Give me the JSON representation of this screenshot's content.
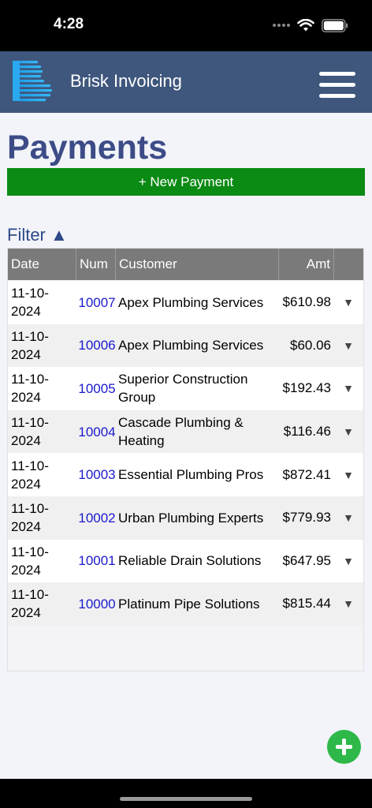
{
  "status_bar": {
    "time": "4:28"
  },
  "header": {
    "app_title": "Brisk Invoicing"
  },
  "page": {
    "title": "Payments",
    "new_payment_label": "+ New Payment",
    "filter_label": "Filter ▲"
  },
  "table": {
    "columns": {
      "date": "Date",
      "num": "Num",
      "customer": "Customer",
      "amt": "Amt"
    },
    "rows": [
      {
        "date": "11-10-2024",
        "num": "10007",
        "customer": "Apex Plumbing Services",
        "amt": "$610.98"
      },
      {
        "date": "11-10-2024",
        "num": "10006",
        "customer": "Apex Plumbing Services",
        "amt": "$60.06"
      },
      {
        "date": "11-10-2024",
        "num": "10005",
        "customer": "Superior Construction Group",
        "amt": "$192.43"
      },
      {
        "date": "11-10-2024",
        "num": "10004",
        "customer": "Cascade Plumbing & Heating",
        "amt": "$116.46"
      },
      {
        "date": "11-10-2024",
        "num": "10003",
        "customer": "Essential Plumbing Pros",
        "amt": "$872.41"
      },
      {
        "date": "11-10-2024",
        "num": "10002",
        "customer": "Urban Plumbing Experts",
        "amt": "$779.93"
      },
      {
        "date": "11-10-2024",
        "num": "10001",
        "customer": "Reliable Drain Solutions",
        "amt": "$647.95"
      },
      {
        "date": "11-10-2024",
        "num": "10000",
        "customer": "Platinum Pipe Solutions",
        "amt": "$815.44"
      }
    ],
    "expand_glyph": "▼"
  },
  "icons": {
    "logo": "brisk-logo",
    "menu": "hamburger-menu-icon",
    "fab": "plus-circle-icon",
    "wifi": "wifi-icon",
    "battery": "battery-icon"
  },
  "colors": {
    "header_bg": "#3f577d",
    "title": "#3d4c87",
    "new_payment_bg": "#0b8a14",
    "table_header_bg": "#7a7a7a",
    "link": "#1a1acc",
    "fab": "#2fb84a"
  }
}
